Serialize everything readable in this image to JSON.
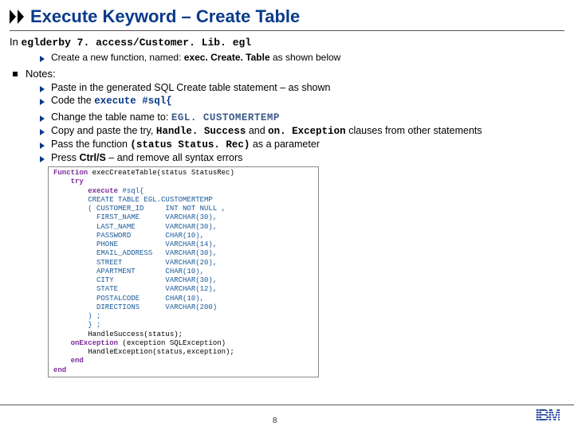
{
  "title": "Execute Keyword – Create Table",
  "line_in_prefix": "In",
  "line_in_file": "eglderby 7. access/Customer. Lib. egl",
  "sub_create_prefix": "Create a new function, named:",
  "sub_create_name": "exec. Create. Table",
  "sub_create_suffix": "as shown below",
  "notes_label": "Notes:",
  "n1": "Paste in the generated SQL Create table statement – as shown",
  "n2a": "Code the",
  "n2b": "execute #sql{",
  "n3a": "Change the table name to:",
  "n3b": "EGL. CUSTOMERTEMP",
  "n4a": "Copy and paste the try,",
  "n4b": "Handle. Success",
  "n4c": "and",
  "n4d": "on. Exception",
  "n4e": "clauses from other statements",
  "n5a": "Pass the function",
  "n5b": "(status Status. Rec)",
  "n5c": "as a parameter",
  "n6a": "Press",
  "n6b": "Ctrl/S",
  "n6c": "– and remove all syntax errors",
  "code": {
    "l1a": "Function",
    "l1b": " execCreateTable(status StatusRec)",
    "l2": "    try",
    "l3a": "        execute",
    "l3b": " #sql{",
    "l4": "        CREATE TABLE EGL.CUSTOMERTEMP",
    "l5": "        ( CUSTOMER_ID     INT NOT NULL ,",
    "l6": "          FIRST_NAME      VARCHAR(30),",
    "l7": "          LAST_NAME       VARCHAR(30),",
    "l8": "          PASSWORD        CHAR(10),",
    "l9": "          PHONE           VARCHAR(14),",
    "l10": "          EMAIL_ADDRESS   VARCHAR(30),",
    "l11": "          STREET          VARCHAR(20),",
    "l12": "          APARTMENT       CHAR(10),",
    "l13": "          CITY            VARCHAR(30),",
    "l14": "          STATE           VARCHAR(12),",
    "l15": "          POSTALCODE      CHAR(10),",
    "l16": "          DIRECTIONS      VARCHAR(200)",
    "l17": "        ) ;",
    "l18": "        } ;",
    "l19": "        HandleSuccess(status);",
    "l20a": "    onException",
    "l20b": " (exception SQLException)",
    "l21": "        HandleException(status,exception);",
    "l22": "    end",
    "l23": "end"
  },
  "page_number": "8",
  "logo": "IBM"
}
